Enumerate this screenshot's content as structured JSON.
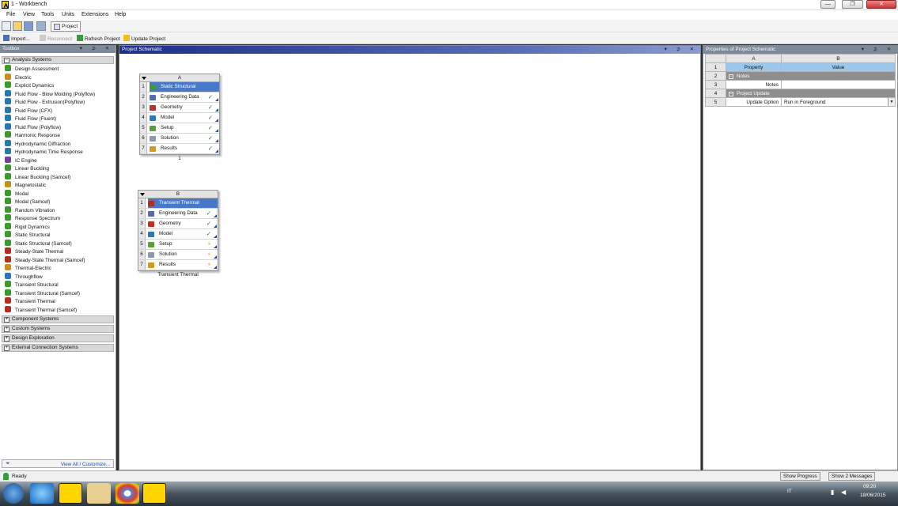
{
  "window": {
    "title": "1 - Workbench",
    "min": "—",
    "max": "❐",
    "close": "✕"
  },
  "menu": [
    "File",
    "View",
    "Tools",
    "Units",
    "Extensions",
    "Help"
  ],
  "toolbar": {
    "tab": "Project",
    "import": "Import...",
    "reconnect": "Reconnect",
    "refresh": "Refresh Project",
    "update": "Update Project"
  },
  "toolbox": {
    "title": "Toolbox",
    "controls": "▾ ⊅ ✕",
    "analysis_header": "Analysis Systems",
    "analysis_items": [
      {
        "label": "Design Assessment",
        "color": "#3a9a2a"
      },
      {
        "label": "Electric",
        "color": "#c89018"
      },
      {
        "label": "Explicit Dynamics",
        "color": "#3a9a2a"
      },
      {
        "label": "Fluid Flow - Blow Molding (Polyflow)",
        "color": "#2a78b0"
      },
      {
        "label": "Fluid Flow - Extrusion(Polyflow)",
        "color": "#2a78b0"
      },
      {
        "label": "Fluid Flow (CFX)",
        "color": "#2a78b0"
      },
      {
        "label": "Fluid Flow (Fluent)",
        "color": "#2a78b0"
      },
      {
        "label": "Fluid Flow (Polyflow)",
        "color": "#2a78b0"
      },
      {
        "label": "Harmonic Response",
        "color": "#3a9a2a"
      },
      {
        "label": "Hydrodynamic Diffraction",
        "color": "#2a78b0"
      },
      {
        "label": "Hydrodynamic Time Response",
        "color": "#2a78b0"
      },
      {
        "label": "IC Engine",
        "color": "#7040a0"
      },
      {
        "label": "Linear Buckling",
        "color": "#3a9a2a"
      },
      {
        "label": "Linear Buckling (Samcef)",
        "color": "#3a9a2a"
      },
      {
        "label": "Magnetostatic",
        "color": "#c89018"
      },
      {
        "label": "Modal",
        "color": "#3a9a2a"
      },
      {
        "label": "Modal (Samcef)",
        "color": "#3a9a2a"
      },
      {
        "label": "Random Vibration",
        "color": "#3a9a2a"
      },
      {
        "label": "Response Spectrum",
        "color": "#3a9a2a"
      },
      {
        "label": "Rigid Dynamics",
        "color": "#3a9a2a"
      },
      {
        "label": "Static Structural",
        "color": "#3a9a2a"
      },
      {
        "label": "Static Structural (Samcef)",
        "color": "#3a9a2a"
      },
      {
        "label": "Steady-State Thermal",
        "color": "#b03020"
      },
      {
        "label": "Steady-State Thermal (Samcef)",
        "color": "#b03020"
      },
      {
        "label": "Thermal-Electric",
        "color": "#c89018"
      },
      {
        "label": "Throughflow",
        "color": "#2a78b0"
      },
      {
        "label": "Transient Structural",
        "color": "#3a9a2a"
      },
      {
        "label": "Transient Structural (Samcef)",
        "color": "#3a9a2a"
      },
      {
        "label": "Transient Thermal",
        "color": "#b03020"
      },
      {
        "label": "Transient Thermal (Samcef)",
        "color": "#b03020"
      }
    ],
    "groups": [
      "Component Systems",
      "Custom Systems",
      "Design Exploration",
      "External Connection Systems"
    ],
    "view_all": "View All / Customize..."
  },
  "schematic": {
    "title": "Project Schematic",
    "systems": [
      {
        "column": "A",
        "title": "Static Structural",
        "caption": "1",
        "rows": [
          {
            "n": "2",
            "label": "Engineering Data",
            "status": "✓",
            "icon": "#5a6ab0"
          },
          {
            "n": "3",
            "label": "Geometry",
            "status": "✓",
            "icon": "#c0302a"
          },
          {
            "n": "4",
            "label": "Model",
            "status": "✓",
            "icon": "#2a7ab8"
          },
          {
            "n": "5",
            "label": "Setup",
            "status": "✓",
            "icon": "#5aa03a"
          },
          {
            "n": "6",
            "label": "Solution",
            "status": "✓",
            "icon": "#8a9aaa"
          },
          {
            "n": "7",
            "label": "Results",
            "status": "✓",
            "icon": "#d09a1a"
          }
        ]
      },
      {
        "column": "B",
        "title": "Transient Thermal",
        "caption": "Transient Thermal",
        "rows": [
          {
            "n": "2",
            "label": "Engineering Data",
            "status": "✓",
            "icon": "#5a6ab0"
          },
          {
            "n": "3",
            "label": "Geometry",
            "status": "✓",
            "icon": "#c0302a"
          },
          {
            "n": "4",
            "label": "Model",
            "status": "✓",
            "icon": "#2a7ab8"
          },
          {
            "n": "5",
            "label": "Setup",
            "status": "⚡",
            "icon": "#5aa03a"
          },
          {
            "n": "6",
            "label": "Solution",
            "status": "⚡",
            "icon": "#8a9aaa"
          },
          {
            "n": "7",
            "label": "Results",
            "status": "⚡",
            "icon": "#d09a1a"
          }
        ]
      }
    ]
  },
  "properties": {
    "title": "Properties of Project Schematic",
    "col_a": "A",
    "col_b": "B",
    "rows": [
      {
        "n": "1",
        "a": "Property",
        "b": "Value",
        "kind": "hdr"
      },
      {
        "n": "2",
        "a": "Notes",
        "b": "",
        "kind": "grp"
      },
      {
        "n": "3",
        "a": "Notes",
        "b": "",
        "kind": "val"
      },
      {
        "n": "4",
        "a": "Project Update",
        "b": "",
        "kind": "grp"
      },
      {
        "n": "5",
        "a": "Update Option",
        "b": "Run in Foreground",
        "kind": "sel"
      }
    ]
  },
  "status": {
    "text": "Ready",
    "show_progress": "Show Progress",
    "show_messages": "Show 2 Messages"
  },
  "taskbar": {
    "lang": "IT",
    "time": "09:20",
    "date": "18/06/2015"
  }
}
